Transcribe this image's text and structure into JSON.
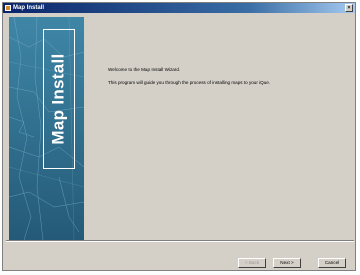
{
  "window": {
    "title": "Map Install"
  },
  "side_panel": {
    "label": "Map Install"
  },
  "content": {
    "welcome": "Welcome to the Map Install Wizard.",
    "description": "This program will guide you through the process of installing maps to your iQue."
  },
  "buttons": {
    "back": "< Back",
    "next": "Next >",
    "cancel": "Cancel"
  },
  "titlebar_buttons": {
    "close": "×"
  }
}
